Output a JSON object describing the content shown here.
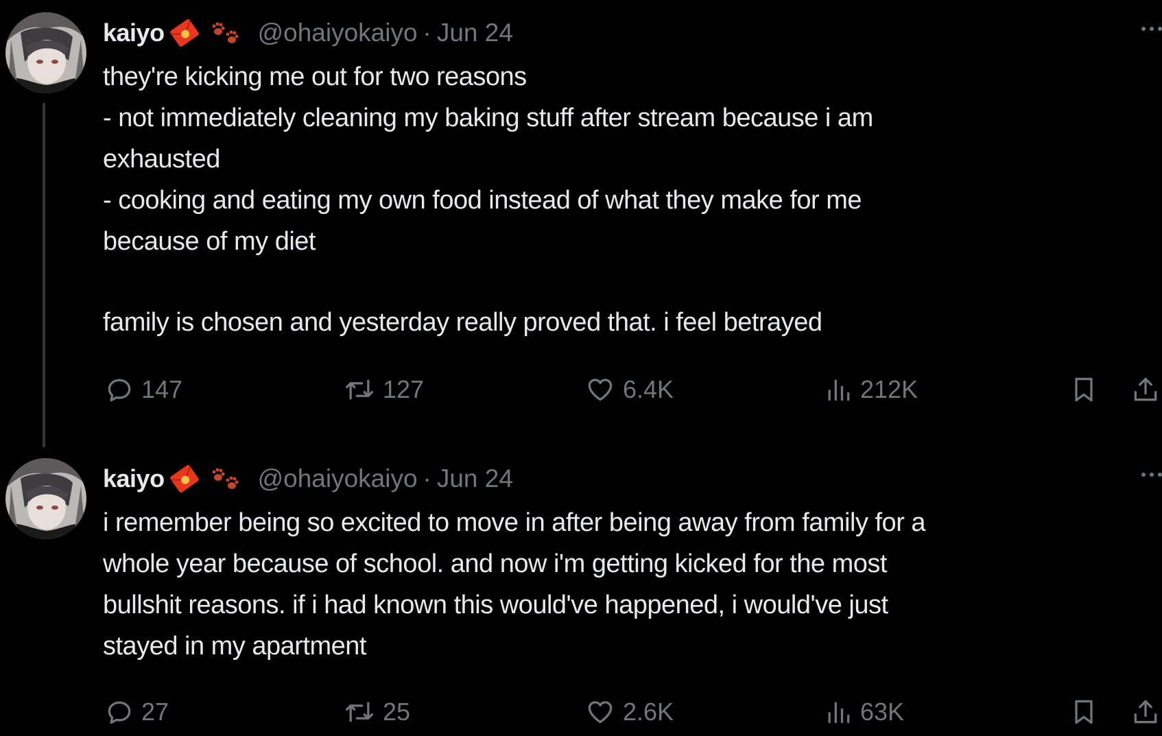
{
  "tweets": [
    {
      "name": "kaiyo",
      "handle": "@ohaiyokaiyo",
      "separator": "·",
      "date": "Jun 24",
      "icons": [
        "red-envelope-badge-icon",
        "paw-prints-icon",
        "more-icon"
      ],
      "lines": [
        "they're kicking me out for two reasons",
        "- not immediately cleaning my baking stuff after stream because i am",
        "exhausted",
        "- cooking and eating my own food instead of what they make for me",
        "because of my diet",
        "",
        "family is chosen and yesterday really proved that. i feel betrayed"
      ],
      "replies": "147",
      "retweets": "127",
      "likes": "6.4K",
      "views": "212K"
    },
    {
      "name": "kaiyo",
      "handle": "@ohaiyokaiyo",
      "separator": "·",
      "date": "Jun 24",
      "icons": [
        "red-envelope-badge-icon",
        "paw-prints-icon",
        "more-icon"
      ],
      "lines": [
        "i remember being so excited to move in after being away from family for a",
        "whole year because of school. and now i'm getting kicked for the most",
        "bullshit reasons. if i had known this would've happened, i would've just",
        "stayed in my apartment"
      ],
      "replies": "27",
      "retweets": "25",
      "likes": "2.6K",
      "views": "63K"
    }
  ],
  "colors": {
    "background": "#000000",
    "text": "#e7e9ea",
    "secondary": "#71767b",
    "thread_line": "#333639",
    "badge": "#e8361f",
    "paw": "#c4452a"
  }
}
